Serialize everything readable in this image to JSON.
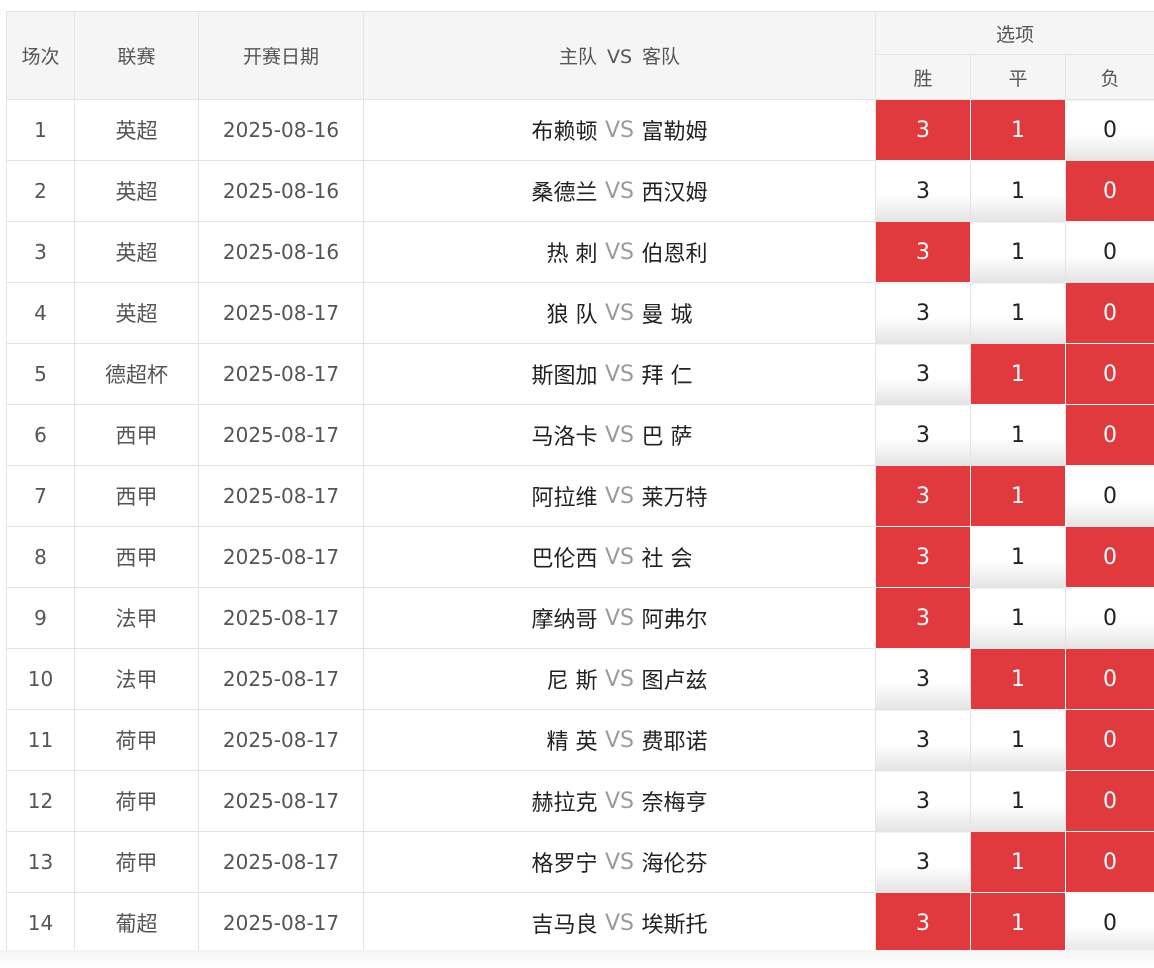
{
  "headers": {
    "index": "场次",
    "league": "联赛",
    "date": "开赛日期",
    "home": "主队",
    "vs": "VS",
    "away": "客队",
    "options": "选项",
    "win": "胜",
    "draw": "平",
    "loss": "负"
  },
  "option_values": [
    "3",
    "1",
    "0"
  ],
  "selected_color": "#e03a3e",
  "rows": [
    {
      "index": "1",
      "league": "英超",
      "date": "2025-08-16",
      "home": "布赖顿",
      "vs": "VS",
      "away": "富勒姆",
      "win": "3",
      "draw": "1",
      "loss": "0",
      "selected": [
        true,
        true,
        false
      ]
    },
    {
      "index": "2",
      "league": "英超",
      "date": "2025-08-16",
      "home": "桑德兰",
      "vs": "VS",
      "away": "西汉姆",
      "win": "3",
      "draw": "1",
      "loss": "0",
      "selected": [
        false,
        false,
        true
      ]
    },
    {
      "index": "3",
      "league": "英超",
      "date": "2025-08-16",
      "home": "热 刺",
      "vs": "VS",
      "away": "伯恩利",
      "win": "3",
      "draw": "1",
      "loss": "0",
      "selected": [
        true,
        false,
        false
      ]
    },
    {
      "index": "4",
      "league": "英超",
      "date": "2025-08-17",
      "home": "狼 队",
      "vs": "VS",
      "away": "曼 城",
      "win": "3",
      "draw": "1",
      "loss": "0",
      "selected": [
        false,
        false,
        true
      ]
    },
    {
      "index": "5",
      "league": "德超杯",
      "date": "2025-08-17",
      "home": "斯图加",
      "vs": "VS",
      "away": "拜 仁",
      "win": "3",
      "draw": "1",
      "loss": "0",
      "selected": [
        false,
        true,
        true
      ]
    },
    {
      "index": "6",
      "league": "西甲",
      "date": "2025-08-17",
      "home": "马洛卡",
      "vs": "VS",
      "away": "巴 萨",
      "win": "3",
      "draw": "1",
      "loss": "0",
      "selected": [
        false,
        false,
        true
      ]
    },
    {
      "index": "7",
      "league": "西甲",
      "date": "2025-08-17",
      "home": "阿拉维",
      "vs": "VS",
      "away": "莱万特",
      "win": "3",
      "draw": "1",
      "loss": "0",
      "selected": [
        true,
        true,
        false
      ]
    },
    {
      "index": "8",
      "league": "西甲",
      "date": "2025-08-17",
      "home": "巴伦西",
      "vs": "VS",
      "away": "社 会",
      "win": "3",
      "draw": "1",
      "loss": "0",
      "selected": [
        true,
        false,
        true
      ]
    },
    {
      "index": "9",
      "league": "法甲",
      "date": "2025-08-17",
      "home": "摩纳哥",
      "vs": "VS",
      "away": "阿弗尔",
      "win": "3",
      "draw": "1",
      "loss": "0",
      "selected": [
        true,
        false,
        false
      ]
    },
    {
      "index": "10",
      "league": "法甲",
      "date": "2025-08-17",
      "home": "尼 斯",
      "vs": "VS",
      "away": "图卢兹",
      "win": "3",
      "draw": "1",
      "loss": "0",
      "selected": [
        false,
        true,
        true
      ]
    },
    {
      "index": "11",
      "league": "荷甲",
      "date": "2025-08-17",
      "home": "精 英",
      "vs": "VS",
      "away": "费耶诺",
      "win": "3",
      "draw": "1",
      "loss": "0",
      "selected": [
        false,
        false,
        true
      ]
    },
    {
      "index": "12",
      "league": "荷甲",
      "date": "2025-08-17",
      "home": "赫拉克",
      "vs": "VS",
      "away": "奈梅亨",
      "win": "3",
      "draw": "1",
      "loss": "0",
      "selected": [
        false,
        false,
        true
      ]
    },
    {
      "index": "13",
      "league": "荷甲",
      "date": "2025-08-17",
      "home": "格罗宁",
      "vs": "VS",
      "away": "海伦芬",
      "win": "3",
      "draw": "1",
      "loss": "0",
      "selected": [
        false,
        true,
        true
      ]
    },
    {
      "index": "14",
      "league": "葡超",
      "date": "2025-08-17",
      "home": "吉马良",
      "vs": "VS",
      "away": "埃斯托",
      "win": "3",
      "draw": "1",
      "loss": "0",
      "selected": [
        true,
        true,
        false
      ]
    }
  ]
}
